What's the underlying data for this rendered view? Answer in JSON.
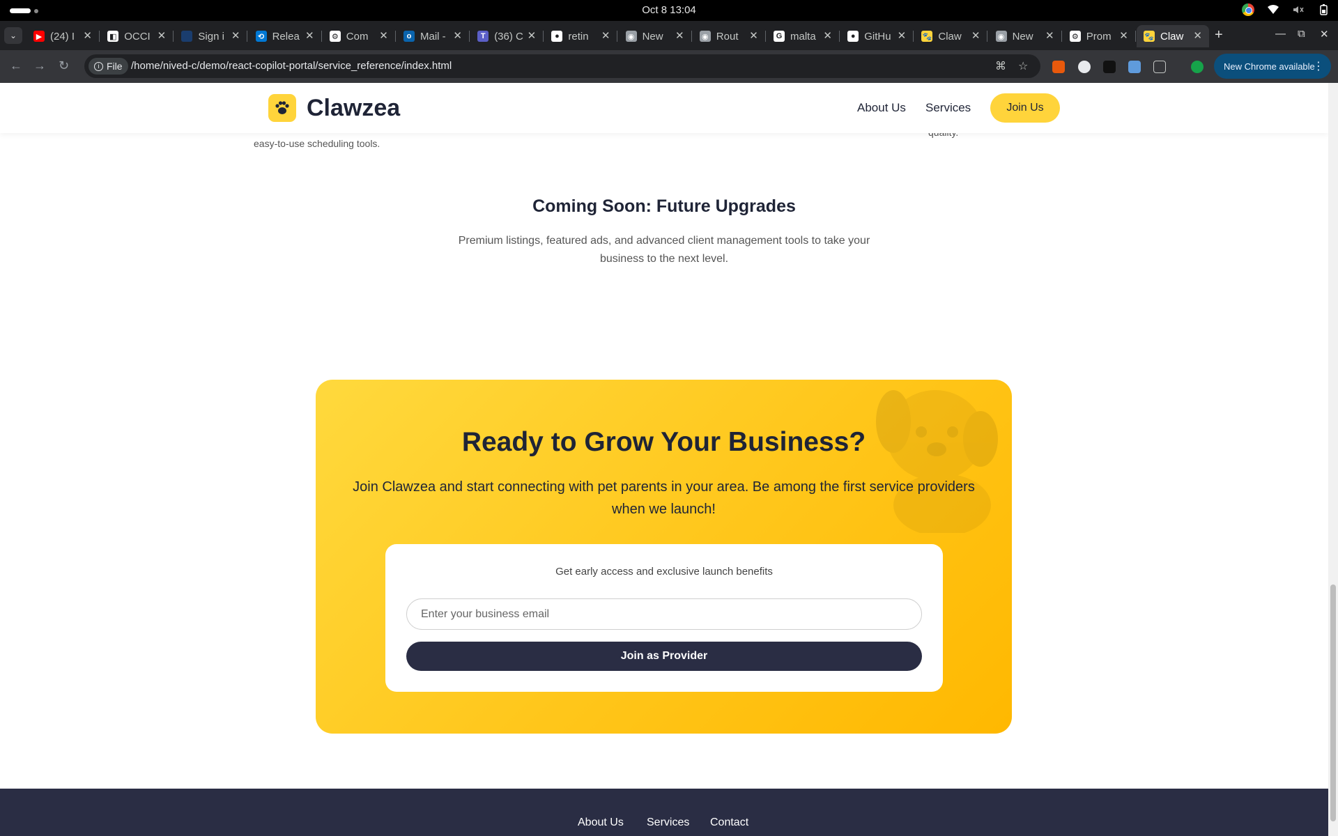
{
  "os": {
    "clock": "Oct 8  13:04"
  },
  "tabs": [
    {
      "label": "(24) I",
      "fav_color": "#ff0000",
      "fav_glyph": "▶"
    },
    {
      "label": "OCCI",
      "fav_color": "#ffffff",
      "fav_glyph": "◧"
    },
    {
      "label": "Sign i",
      "fav_color": "#1a3d6e",
      "fav_glyph": ""
    },
    {
      "label": "Relea",
      "fav_color": "#0078d4",
      "fav_glyph": "⟲"
    },
    {
      "label": "Com",
      "fav_color": "#ffffff",
      "fav_glyph": "⚙"
    },
    {
      "label": "Mail -",
      "fav_color": "#0a64ad",
      "fav_glyph": "o"
    },
    {
      "label": "(36) C",
      "fav_color": "#5b5fc7",
      "fav_glyph": "T"
    },
    {
      "label": "retin",
      "fav_color": "#ffffff",
      "fav_glyph": "●"
    },
    {
      "label": "New",
      "fav_color": "#9aa0a6",
      "fav_glyph": "◉"
    },
    {
      "label": "Rout",
      "fav_color": "#9aa0a6",
      "fav_glyph": "◉"
    },
    {
      "label": "malta",
      "fav_color": "#ffffff",
      "fav_glyph": "G"
    },
    {
      "label": "GitHu",
      "fav_color": "#ffffff",
      "fav_glyph": "●"
    },
    {
      "label": "Claw",
      "fav_color": "#ffd43b",
      "fav_glyph": "🐾"
    },
    {
      "label": "New",
      "fav_color": "#9aa0a6",
      "fav_glyph": "◉"
    },
    {
      "label": "Prom",
      "fav_color": "#ffffff",
      "fav_glyph": "⚙"
    },
    {
      "label": "Claw",
      "fav_color": "#ffd43b",
      "fav_glyph": "🐾",
      "active": true
    }
  ],
  "toolbar": {
    "file_chip": "File",
    "url": "/home/nived-c/demo/react-copilot-portal/service_reference/index.html",
    "update_label": "New Chrome available"
  },
  "header": {
    "brand": "Clawzea",
    "nav": [
      "About Us",
      "Services"
    ],
    "join_label": "Join Us"
  },
  "fragments": {
    "left": "easy-to-use scheduling tools.",
    "right": "quality."
  },
  "coming_soon": {
    "title": "Coming Soon: Future Upgrades",
    "description": "Premium listings, featured ads, and advanced client management tools to take your business to the next level."
  },
  "cta": {
    "title": "Ready to Grow Your Business?",
    "subtitle": "Join Clawzea and start connecting with pet parents in your area. Be among the first service providers when we launch!",
    "box_text": "Get early access and exclusive launch benefits",
    "email_placeholder": "Enter your business email",
    "button_label": "Join as Provider"
  },
  "footer": {
    "links": [
      "About Us",
      "Services",
      "Contact"
    ]
  },
  "colors": {
    "brand_yellow": "#ffd43b",
    "navy": "#1f2436",
    "button_dark": "#2a2d44"
  }
}
